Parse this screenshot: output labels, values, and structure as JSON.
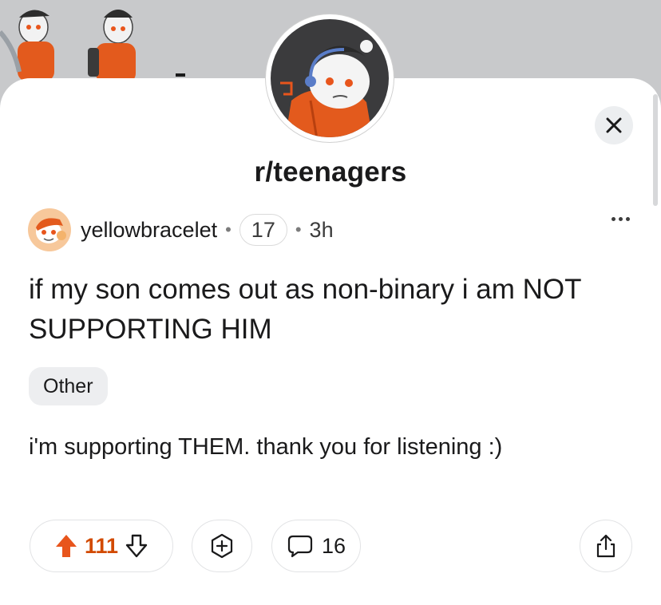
{
  "subreddit": {
    "name": "r/teenagers",
    "avatar_icon": "snoo-mascot-avatar",
    "banner_icon": "mascot-banner-art"
  },
  "close_icon": "close-icon",
  "post": {
    "author": "yellowbracelet",
    "author_karma_badge": "17",
    "age": "3h",
    "title": "if my son comes out as non-binary i am NOT SUPPORTING HIM",
    "flair": "Other",
    "body": "i'm supporting THEM. thank you for listening :)"
  },
  "actions": {
    "votes": "111",
    "comments": "16",
    "upvote_state": "upvoted"
  },
  "colors": {
    "upvote": "#e8551c",
    "vote_count": "#d24a00",
    "banner_bg": "#c8c9cb"
  }
}
